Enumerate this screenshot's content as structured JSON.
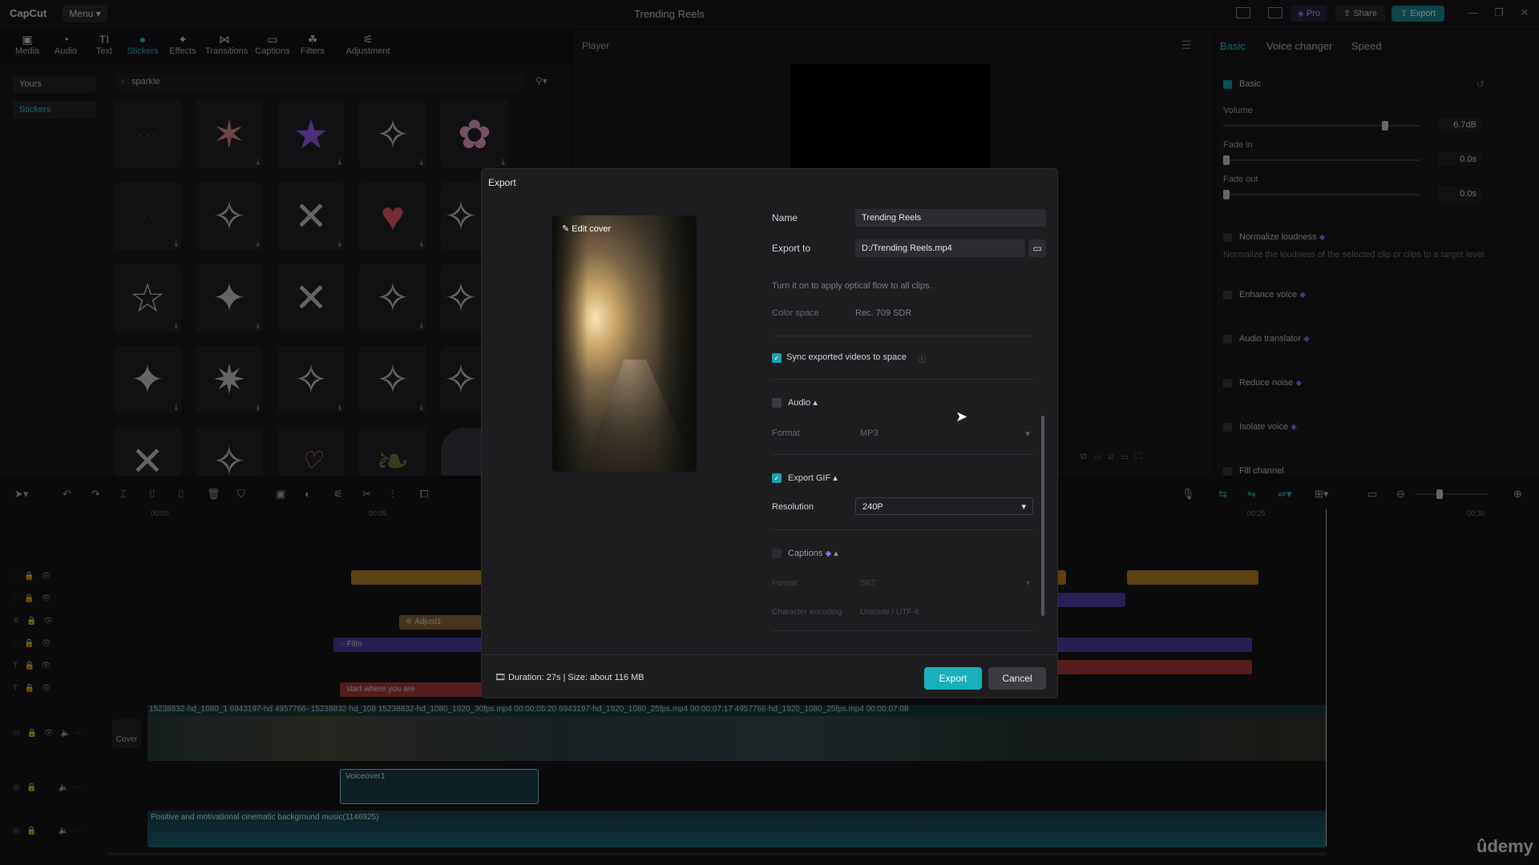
{
  "app": {
    "logo": "CapCut",
    "menu_label": "Menu",
    "title": "Trending Reels",
    "pro_label": "Pro",
    "share_label": "Share",
    "export_label": "Export"
  },
  "toolbar": {
    "items": [
      {
        "label": "Media",
        "icon": "media-icon"
      },
      {
        "label": "Audio",
        "icon": "audio-icon"
      },
      {
        "label": "Text",
        "icon": "text-icon"
      },
      {
        "label": "Stickers",
        "icon": "stickers-icon"
      },
      {
        "label": "Effects",
        "icon": "effects-icon"
      },
      {
        "label": "Transitions",
        "icon": "transitions-icon"
      },
      {
        "label": "Captions",
        "icon": "captions-icon"
      },
      {
        "label": "Filters",
        "icon": "filters-icon"
      },
      {
        "label": "Adjustment",
        "icon": "adjustment-icon"
      }
    ],
    "active": "Stickers"
  },
  "left_panel": {
    "source_select": "Yours",
    "category_select": "Stickers",
    "search_value": "sparkle"
  },
  "player": {
    "title": "Player"
  },
  "right_panel": {
    "tabs": [
      "Basic",
      "Voice changer",
      "Speed"
    ],
    "basic_label": "Basic",
    "volume_label": "Volume",
    "volume_value": "6.7dB",
    "volume_level": 0.82,
    "fade_in_label": "Fade in",
    "fade_in_value": "0.0s",
    "fade_out_label": "Fade out",
    "fade_out_value": "0.0s",
    "normalize_label": "Normalize loudness",
    "normalize_desc": "Normalize the loudness of the selected clip or clips to a target level.",
    "enhance_label": "Enhance voice",
    "translator_label": "Audio translator",
    "reduce_noise_label": "Reduce noise",
    "isolate_label": "Isolate voice",
    "fill_channel_label": "Fill channel"
  },
  "timeline": {
    "ruler": [
      "00:00",
      "00:05",
      "00:25",
      "00:30"
    ],
    "clips": {
      "adjust": "Adjust1",
      "film": "Film",
      "text": "start where you are",
      "video": "15238832-hd_1080_1   6943197-hd   4957766-   15238832-hd_108   15238832-hd_1080_1920_30fps.mp4  00:00:05:20      6943197-hd_1920_1080_25fps.mp4  00:00:07:17      4957766-hd_1920_1080_25fps.mp4  00:00:07:08",
      "cover": "Cover",
      "voiceover": "Voiceover1",
      "music": "Positive and motivational cinematic background music(1146925)"
    }
  },
  "watermark": "ûdemy",
  "dialog": {
    "title": "Export",
    "edit_cover": "Edit cover",
    "name_label": "Name",
    "name_value": "Trending Reels",
    "export_to_label": "Export to",
    "export_to_value": "D:/Trending Reels.mp4",
    "optical_flow_note": "Turn it on to apply optical flow to all clips.",
    "color_space_label": "Color space",
    "color_space_value": "Rec. 709 SDR",
    "sync_label": "Sync exported videos to space",
    "audio_label": "Audio",
    "format_label": "Format",
    "audio_format_value": "MP3",
    "gif_label": "Export GIF",
    "resolution_label": "Resolution",
    "resolution_value": "240P",
    "captions_label": "Captions",
    "captions_format_value": "SRT",
    "encoding_label": "Character encoding",
    "encoding_value": "Unicode / UTF-8",
    "footer_info": "Duration: 27s | Size: about 116 MB",
    "export_button": "Export",
    "cancel_button": "Cancel"
  },
  "colors": {
    "accent": "#1ab0ba",
    "panel": "#18181b",
    "premium": "#8a6cf0"
  }
}
